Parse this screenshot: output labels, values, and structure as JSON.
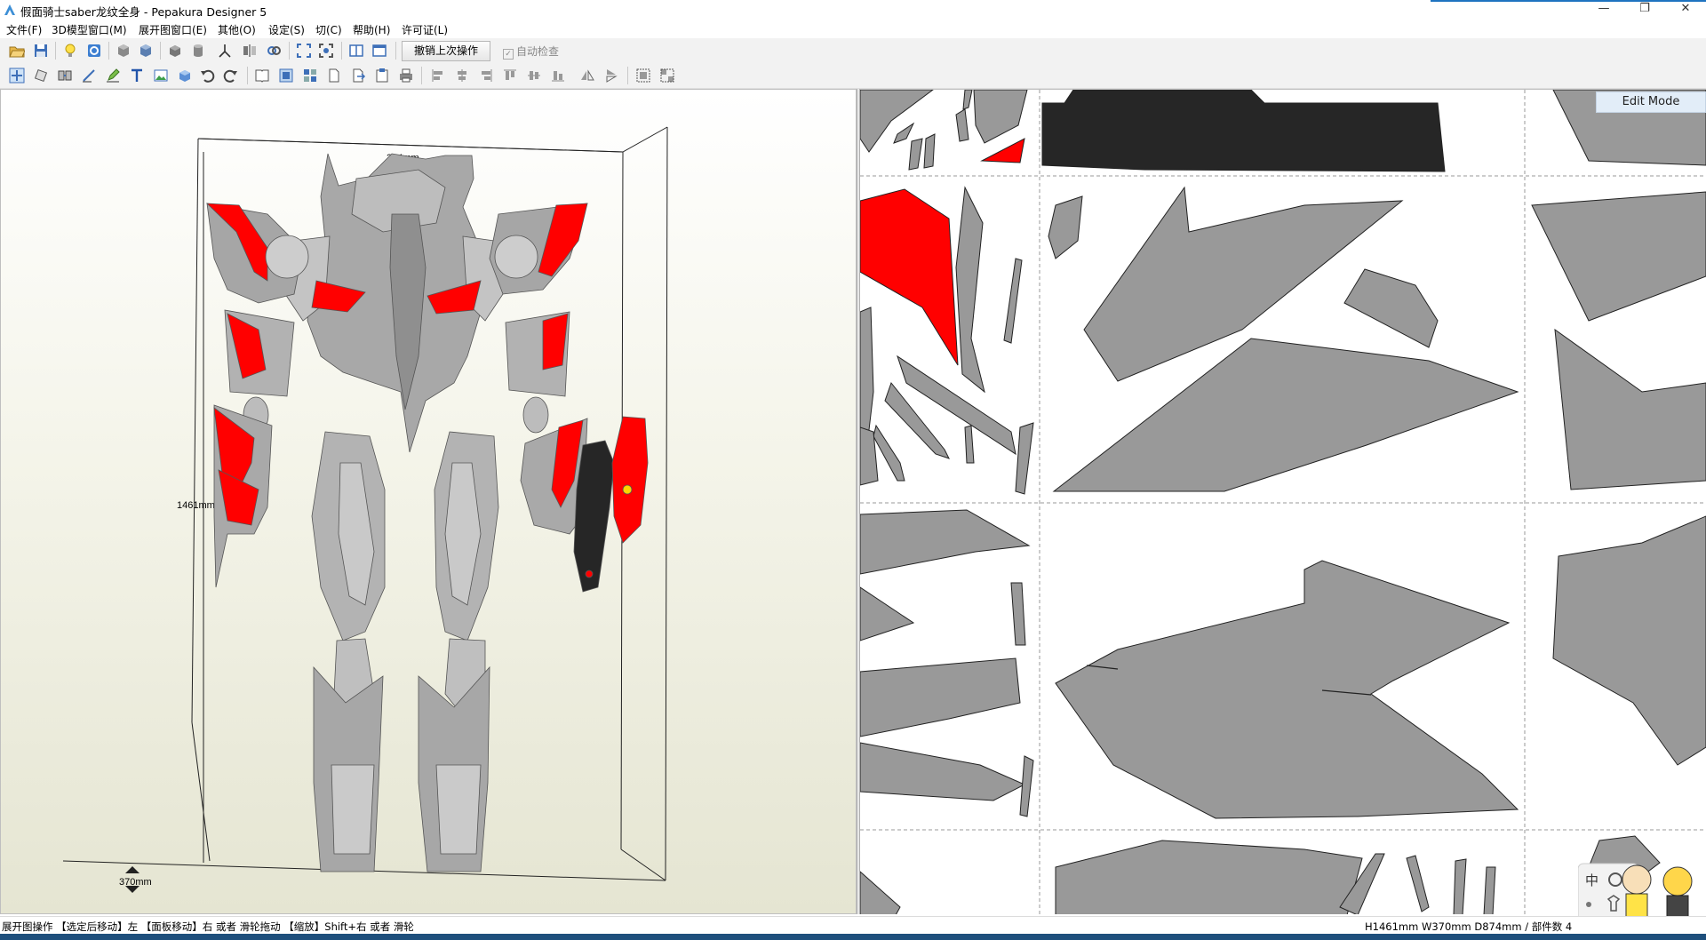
{
  "window": {
    "title": "假面骑士saber龙纹全身 - Pepakura Designer 5",
    "minimize": "—",
    "maximize": "❐",
    "close": "✕"
  },
  "menu": [
    {
      "label": "文件(F)"
    },
    {
      "label": "3D模型窗口(M)"
    },
    {
      "label": "展开图窗口(E)"
    },
    {
      "label": "其他(O)"
    },
    {
      "label": "设定(S)"
    },
    {
      "label": "切(C)"
    },
    {
      "label": "帮助(H)"
    },
    {
      "label": "许可证(L)"
    }
  ],
  "toolbar": {
    "undo_label": "撤销上次操作",
    "auto_check_label": "自动检查",
    "auto_check_checked": true
  },
  "model_view": {
    "dim_width": "374mm",
    "dim_height": "1461mm",
    "dim_depth": "370mm"
  },
  "pattern_view": {
    "mode_label": "Edit Mode"
  },
  "colors": {
    "part_gray": "#999999",
    "part_red": "#ff0000",
    "part_black": "#262626",
    "title_accent": "#1e73c0"
  },
  "status": {
    "hint": "展开图操作 【选定后移动】左 【面板移动】右 或者 滑轮拖动 【缩放】Shift+右 或者 滑轮",
    "dimensions": "H1461mm W370mm D874mm / 部件数 4"
  }
}
